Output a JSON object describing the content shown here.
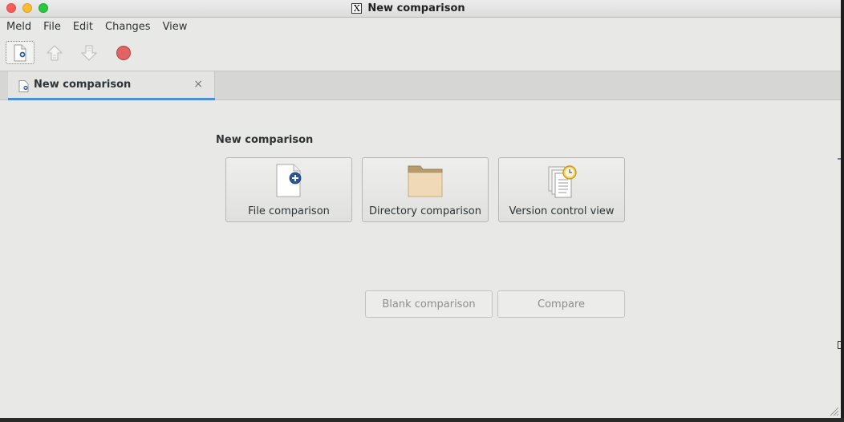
{
  "window": {
    "title": "New comparison"
  },
  "menubar": {
    "items": [
      "Meld",
      "File",
      "Edit",
      "Changes",
      "View"
    ]
  },
  "toolbar": {
    "buttons": [
      {
        "name": "new-comparison-icon"
      },
      {
        "name": "previous-change-icon"
      },
      {
        "name": "next-change-icon"
      },
      {
        "name": "stop-icon"
      }
    ]
  },
  "tabs": [
    {
      "label": "New comparison",
      "close": "×",
      "active": true
    }
  ],
  "main": {
    "heading": "New comparison",
    "options": [
      {
        "label": "File comparison",
        "icon": "file-add-icon"
      },
      {
        "label": "Directory comparison",
        "icon": "folder-icon"
      },
      {
        "label": "Version control view",
        "icon": "version-control-icon"
      }
    ],
    "actions": {
      "blank": "Blank comparison",
      "compare": "Compare"
    }
  },
  "colors": {
    "accent": "#4a90d9",
    "background": "#e8e8e7",
    "disabled_text": "#8c8f8e"
  }
}
